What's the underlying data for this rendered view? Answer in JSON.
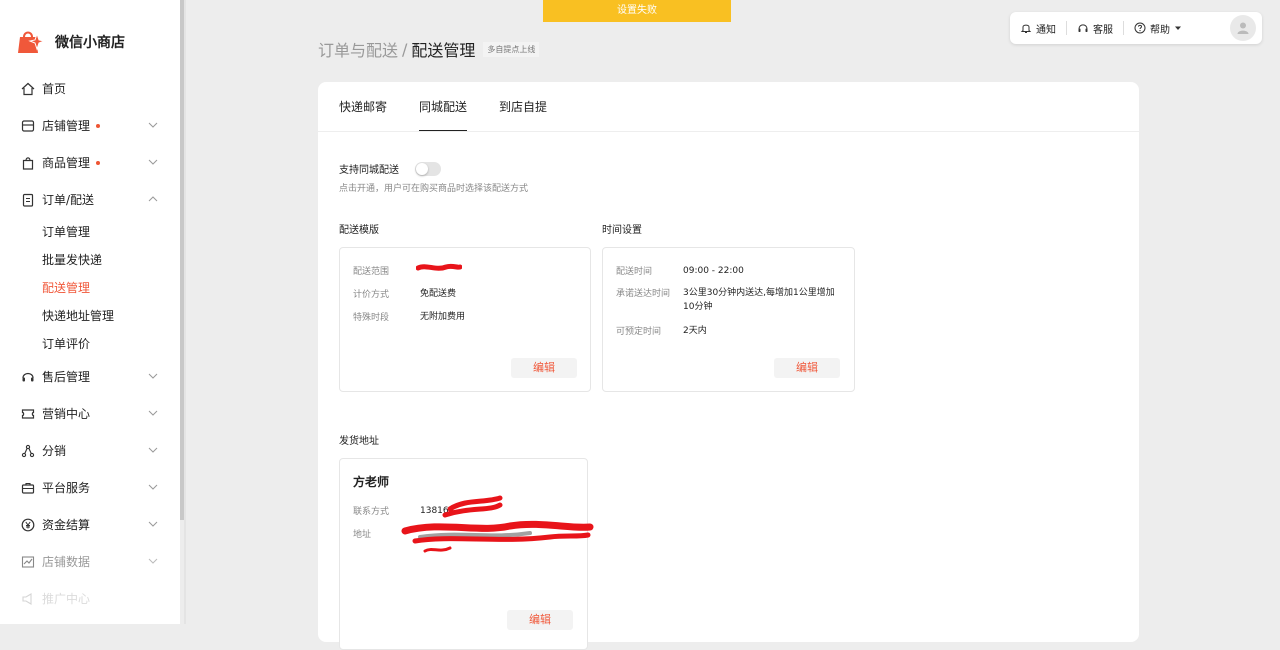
{
  "app": {
    "title": "微信小商店",
    "brand_color": "#f0583a"
  },
  "toast": {
    "text": "设置失败",
    "color": "#f9c022"
  },
  "topbar": {
    "notify": "通知",
    "service": "客服",
    "help": "帮助"
  },
  "sidebar": {
    "items": [
      {
        "label": "首页",
        "icon": "home-icon"
      },
      {
        "label": "店铺管理",
        "icon": "store-icon",
        "dot": true
      },
      {
        "label": "商品管理",
        "icon": "bag-icon",
        "dot": true
      },
      {
        "label": "订单/配送",
        "icon": "order-icon",
        "expanded": true,
        "children": [
          "订单管理",
          "批量发快递",
          "配送管理",
          "快递地址管理",
          "订单评价"
        ],
        "active_child": "配送管理"
      },
      {
        "label": "售后管理",
        "icon": "headset-icon"
      },
      {
        "label": "营销中心",
        "icon": "ticket-icon"
      },
      {
        "label": "分销",
        "icon": "share-icon"
      },
      {
        "label": "平台服务",
        "icon": "briefcase-icon"
      },
      {
        "label": "资金结算",
        "icon": "yen-icon"
      },
      {
        "label": "店铺数据",
        "icon": "chart-icon"
      },
      {
        "label": "推广中心",
        "icon": "megaphone-icon"
      }
    ]
  },
  "breadcrumb": {
    "parent": "订单与配送",
    "separator": "/",
    "current": "配送管理",
    "tag": "多自提点上线"
  },
  "tabs": [
    "快递邮寄",
    "同城配送",
    "到店自提"
  ],
  "active_tab": "同城配送",
  "local_delivery": {
    "toggle_label": "支持同城配送",
    "toggle_on": false,
    "hint": "点击开通，用户可在购买商品时选择该配送方式"
  },
  "template_section": {
    "title": "配送模版",
    "rows": [
      {
        "key": "配送范围",
        "value": ""
      },
      {
        "key": "计价方式",
        "value": "免配送费"
      },
      {
        "key": "特殊时段",
        "value": "无附加费用"
      }
    ],
    "edit": "编辑"
  },
  "time_section": {
    "title": "时间设置",
    "rows": [
      {
        "key": "配送时间",
        "value": "09:00 - 22:00"
      },
      {
        "key": "承诺送达时间",
        "value": "3公里30分钟内送达,每增加1公里增加10分钟"
      },
      {
        "key": "可预定时间",
        "value": "2天内"
      }
    ],
    "edit": "编辑"
  },
  "address_section": {
    "title": "发货地址",
    "name": "方老师",
    "phone_label": "联系方式",
    "phone_value": "13816",
    "address_label": "地址",
    "edit": "编辑"
  }
}
